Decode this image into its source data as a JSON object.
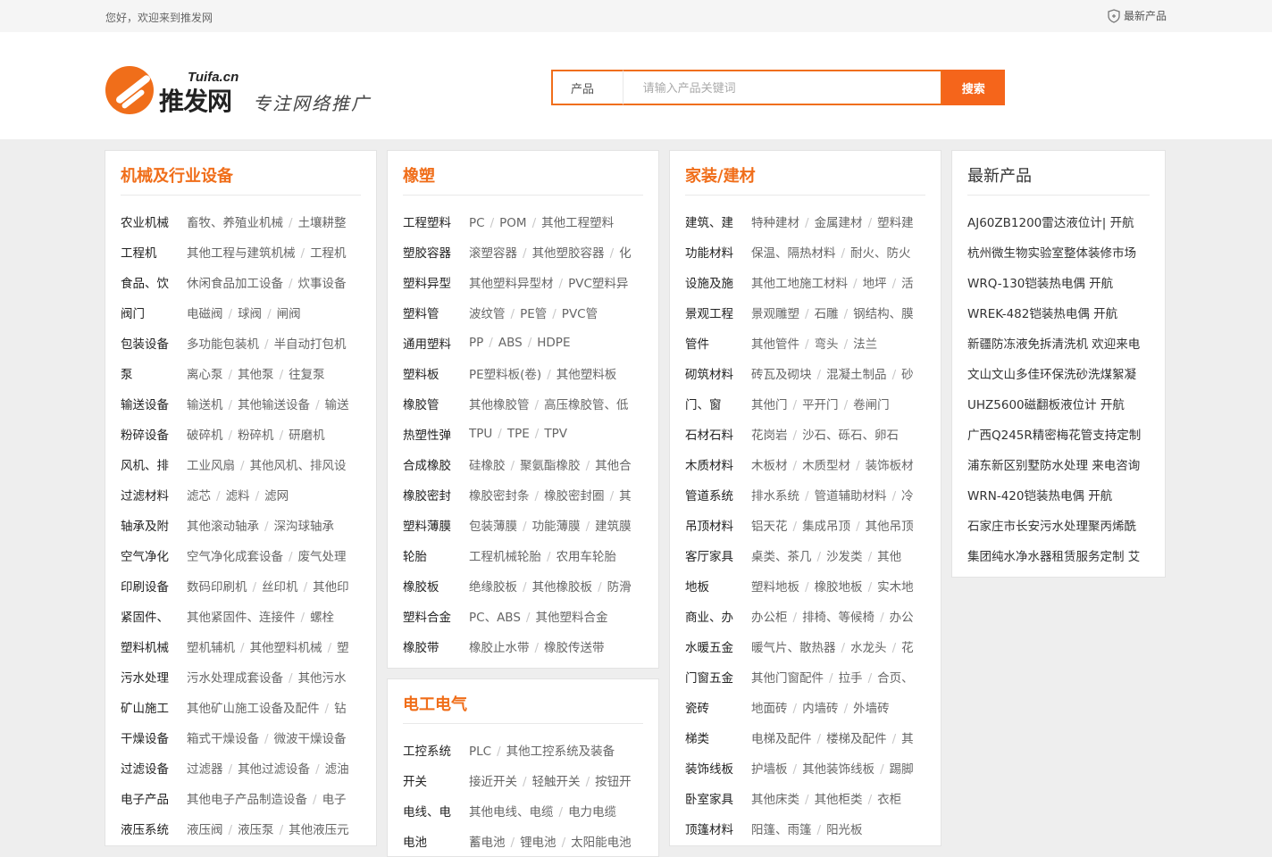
{
  "topbar": {
    "welcome": "您好，欢迎来到推发网",
    "latest": "最新产品",
    "latest_icon": "shield-icon"
  },
  "logo": {
    "en": "Tuifa.cn",
    "cn": "推发网",
    "slogan": "专注网络推广"
  },
  "search": {
    "category": "产品",
    "placeholder": "请输入产品关键词",
    "button": "搜索"
  },
  "panels": [
    {
      "title": "机械及行业设备",
      "rows": [
        {
          "cat": "农业机械",
          "subs": [
            "畜牧、养殖业机械",
            "土壤耕整"
          ]
        },
        {
          "cat": "工程机",
          "subs": [
            "其他工程与建筑机械",
            "工程机"
          ]
        },
        {
          "cat": "食品、饮",
          "subs": [
            "休闲食品加工设备",
            "炊事设备"
          ]
        },
        {
          "cat": "阀门",
          "subs": [
            "电磁阀",
            "球阀",
            "闸阀"
          ]
        },
        {
          "cat": "包装设备",
          "subs": [
            "多功能包装机",
            "半自动打包机"
          ]
        },
        {
          "cat": "泵",
          "subs": [
            "离心泵",
            "其他泵",
            "往复泵"
          ]
        },
        {
          "cat": "输送设备",
          "subs": [
            "输送机",
            "其他输送设备",
            "输送"
          ]
        },
        {
          "cat": "粉碎设备",
          "subs": [
            "破碎机",
            "粉碎机",
            "研磨机"
          ]
        },
        {
          "cat": "风机、排",
          "subs": [
            "工业风扇",
            "其他风机、排风设"
          ]
        },
        {
          "cat": "过滤材料",
          "subs": [
            "滤芯",
            "滤料",
            "滤网"
          ]
        },
        {
          "cat": "轴承及附",
          "subs": [
            "其他滚动轴承",
            "深沟球轴承"
          ]
        },
        {
          "cat": "空气净化",
          "subs": [
            "空气净化成套设备",
            "废气处理"
          ]
        },
        {
          "cat": "印刷设备",
          "subs": [
            "数码印刷机",
            "丝印机",
            "其他印"
          ]
        },
        {
          "cat": "紧固件、",
          "subs": [
            "其他紧固件、连接件",
            "螺栓"
          ]
        },
        {
          "cat": "塑料机械",
          "subs": [
            "塑机辅机",
            "其他塑料机械",
            "塑"
          ]
        },
        {
          "cat": "污水处理",
          "subs": [
            "污水处理成套设备",
            "其他污水"
          ]
        },
        {
          "cat": "矿山施工",
          "subs": [
            "其他矿山施工设备及配件",
            "钻"
          ]
        },
        {
          "cat": "干燥设备",
          "subs": [
            "箱式干燥设备",
            "微波干燥设备"
          ]
        },
        {
          "cat": "过滤设备",
          "subs": [
            "过滤器",
            "其他过滤设备",
            "滤油"
          ]
        },
        {
          "cat": "电子产品",
          "subs": [
            "其他电子产品制造设备",
            "电子"
          ]
        },
        {
          "cat": "液压系统",
          "subs": [
            "液压阀",
            "液压泵",
            "其他液压元"
          ]
        }
      ]
    },
    {
      "title": "橡塑",
      "rows": [
        {
          "cat": "工程塑料",
          "subs": [
            "PC",
            "POM",
            "其他工程塑料"
          ]
        },
        {
          "cat": "塑胶容器",
          "subs": [
            "滚塑容器",
            "其他塑胶容器",
            "化"
          ]
        },
        {
          "cat": "塑料异型",
          "subs": [
            "其他塑料异型材",
            "PVC塑料异"
          ]
        },
        {
          "cat": "塑料管",
          "subs": [
            "波纹管",
            "PE管",
            "PVC管"
          ]
        },
        {
          "cat": "通用塑料",
          "subs": [
            "PP",
            "ABS",
            "HDPE"
          ]
        },
        {
          "cat": "塑料板",
          "subs": [
            "PE塑料板(卷)",
            "其他塑料板"
          ]
        },
        {
          "cat": "橡胶管",
          "subs": [
            "其他橡胶管",
            "高压橡胶管、低"
          ]
        },
        {
          "cat": "热塑性弹",
          "subs": [
            "TPU",
            "TPE",
            "TPV"
          ]
        },
        {
          "cat": "合成橡胶",
          "subs": [
            "硅橡胶",
            "聚氨酯橡胶",
            "其他合"
          ]
        },
        {
          "cat": "橡胶密封",
          "subs": [
            "橡胶密封条",
            "橡胶密封圈",
            "其"
          ]
        },
        {
          "cat": "塑料薄膜",
          "subs": [
            "包装薄膜",
            "功能薄膜",
            "建筑膜"
          ]
        },
        {
          "cat": "轮胎",
          "subs": [
            "工程机械轮胎",
            "农用车轮胎"
          ]
        },
        {
          "cat": "橡胶板",
          "subs": [
            "绝缘胶板",
            "其他橡胶板",
            "防滑"
          ]
        },
        {
          "cat": "塑料合金",
          "subs": [
            "PC、ABS",
            "其他塑料合金"
          ]
        },
        {
          "cat": "橡胶带",
          "subs": [
            "橡胶止水带",
            "橡胶传送带"
          ]
        }
      ]
    },
    {
      "title": "电工电气",
      "rows": [
        {
          "cat": "工控系统",
          "subs": [
            "PLC",
            "其他工控系统及装备"
          ]
        },
        {
          "cat": "开关",
          "subs": [
            "接近开关",
            "轻触开关",
            "按钮开"
          ]
        },
        {
          "cat": "电线、电",
          "subs": [
            "其他电线、电缆",
            "电力电缆"
          ]
        },
        {
          "cat": "电池",
          "subs": [
            "蓄电池",
            "锂电池",
            "太阳能电池"
          ]
        }
      ]
    },
    {
      "title": "家装/建材",
      "rows": [
        {
          "cat": "建筑、建",
          "subs": [
            "特种建材",
            "金属建材",
            "塑料建"
          ]
        },
        {
          "cat": "功能材料",
          "subs": [
            "保温、隔热材料",
            "耐火、防火"
          ]
        },
        {
          "cat": "设施及施",
          "subs": [
            "其他工地施工材料",
            "地坪",
            "活"
          ]
        },
        {
          "cat": "景观工程",
          "subs": [
            "景观雕塑",
            "石雕",
            "钢结构、膜"
          ]
        },
        {
          "cat": "管件",
          "subs": [
            "其他管件",
            "弯头",
            "法兰"
          ]
        },
        {
          "cat": "砌筑材料",
          "subs": [
            "砖瓦及砌块",
            "混凝土制品",
            "砂"
          ]
        },
        {
          "cat": "门、窗",
          "subs": [
            "其他门",
            "平开门",
            "卷闸门"
          ]
        },
        {
          "cat": "石材石料",
          "subs": [
            "花岗岩",
            "沙石、砾石、卵石"
          ]
        },
        {
          "cat": "木质材料",
          "subs": [
            "木板材",
            "木质型材",
            "装饰板材"
          ]
        },
        {
          "cat": "管道系统",
          "subs": [
            "排水系统",
            "管道辅助材料",
            "冷"
          ]
        },
        {
          "cat": "吊顶材料",
          "subs": [
            "铝天花",
            "集成吊顶",
            "其他吊顶"
          ]
        },
        {
          "cat": "客厅家具",
          "subs": [
            "桌类、茶几",
            "沙发类",
            "其他"
          ]
        },
        {
          "cat": "地板",
          "subs": [
            "塑料地板",
            "橡胶地板",
            "实木地"
          ]
        },
        {
          "cat": "商业、办",
          "subs": [
            "办公柜",
            "排椅、等候椅",
            "办公"
          ]
        },
        {
          "cat": "水暖五金",
          "subs": [
            "暖气片、散热器",
            "水龙头",
            "花"
          ]
        },
        {
          "cat": "门窗五金",
          "subs": [
            "其他门窗配件",
            "拉手",
            "合页、"
          ]
        },
        {
          "cat": "瓷砖",
          "subs": [
            "地面砖",
            "内墙砖",
            "外墙砖"
          ]
        },
        {
          "cat": "梯类",
          "subs": [
            "电梯及配件",
            "楼梯及配件",
            "其"
          ]
        },
        {
          "cat": "装饰线板",
          "subs": [
            "护墙板",
            "其他装饰线板",
            "踢脚"
          ]
        },
        {
          "cat": "卧室家具",
          "subs": [
            "其他床类",
            "其他柜类",
            "衣柜"
          ]
        },
        {
          "cat": "顶篷材料",
          "subs": [
            "阳篷、雨篷",
            "阳光板"
          ]
        }
      ]
    }
  ],
  "latest_panel": {
    "title": "最新产品",
    "items": [
      "AJ60ZB1200雷达液位计| 开航",
      "杭州微生物实验室整体装修市场",
      "WRQ-130铠装热电偶 开航",
      "WREK-482铠装热电偶 开航",
      "新疆防冻液免拆清洗机 欢迎来电",
      "文山文山多佳环保洗砂洗煤絮凝",
      "UHZ5600磁翻板液位计 开航",
      "广西Q245R精密梅花管支持定制",
      "浦东新区别墅防水处理 来电咨询",
      "WRN-420铠装热电偶 开航",
      "石家庄市长安污水处理聚丙烯酰",
      "集团纯水净水器租赁服务定制 艾"
    ]
  }
}
